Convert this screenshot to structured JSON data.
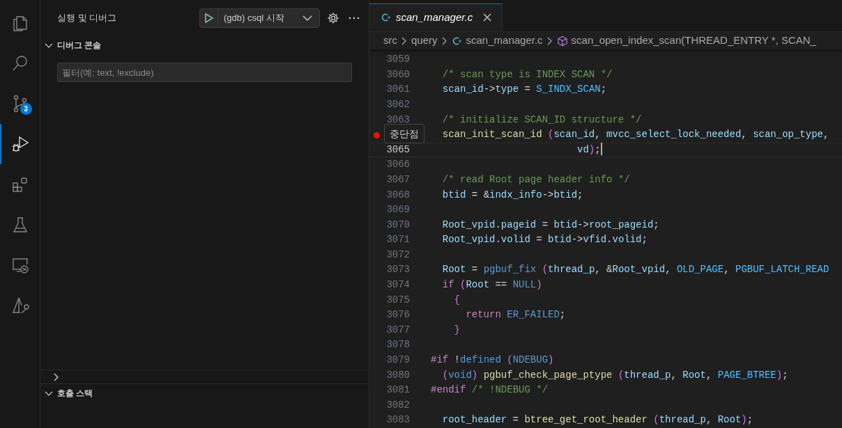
{
  "activity_bar": {
    "items": [
      {
        "kind": "files",
        "selected": false
      },
      {
        "kind": "search",
        "selected": false
      },
      {
        "kind": "source-control",
        "selected": false,
        "badge": "3"
      },
      {
        "kind": "run-debug",
        "selected": true
      },
      {
        "kind": "extensions",
        "selected": false
      },
      {
        "kind": "flask",
        "selected": false
      },
      {
        "kind": "remote",
        "selected": false
      },
      {
        "kind": "wrench-triangle",
        "selected": false
      }
    ]
  },
  "sidebar": {
    "title": "실행 및 디버그",
    "launch_config": "(gdb) csql 시작",
    "sections": [
      {
        "title": "디버그 콘솔",
        "expanded": true,
        "filter": {
          "placeholder": "필터(예: text, !exclude)"
        }
      },
      {
        "expanded": false
      },
      {
        "title": "호출 스택",
        "expanded": true
      }
    ]
  },
  "editor": {
    "tabs": [
      {
        "label": "scan_manager.c",
        "selected": true,
        "preview": true
      }
    ],
    "breadcrumbs": [
      {
        "label": "src",
        "kind": "folder"
      },
      {
        "label": "query",
        "kind": "folder"
      },
      {
        "label": "scan_manager.c",
        "kind": "file"
      },
      {
        "label": "scan_open_index_scan(THREAD_ENTRY *, SCAN_",
        "kind": "symbol"
      }
    ],
    "tooltip": "중단점",
    "lines": [
      {
        "number": "3059",
        "breakpoint": false,
        "current": false
      },
      {
        "number": "3060",
        "breakpoint": false,
        "current": false,
        "tokens": [
          {
            "kind": "comment",
            "text": "  /* scan type is INDEX SCAN */"
          }
        ]
      },
      {
        "number": "3061",
        "breakpoint": false,
        "current": false,
        "tokens": [
          {
            "kind": "variable",
            "text": "  scan_id"
          },
          {
            "kind": "punctuation",
            "text": "->"
          },
          {
            "kind": "variable",
            "text": "type"
          },
          {
            "kind": "punctuation",
            "text": " = "
          },
          {
            "kind": "constant",
            "text": "S_INDX_SCAN"
          },
          {
            "kind": "punctuation",
            "text": ";"
          }
        ]
      },
      {
        "number": "3062",
        "breakpoint": false,
        "current": false
      },
      {
        "number": "3063",
        "breakpoint": false,
        "current": false,
        "tokens": [
          {
            "kind": "comment",
            "text": "  /* initialize SCAN_ID structure */"
          }
        ]
      },
      {
        "breakpoint": true,
        "current": false,
        "tokens": [
          {
            "kind": "function",
            "text": "  scan_init_scan_id"
          },
          {
            "kind": "bracket",
            "text": " ("
          },
          {
            "kind": "variable",
            "text": "scan_id"
          },
          {
            "kind": "punctuation",
            "text": ", "
          },
          {
            "kind": "variable",
            "text": "mvcc_select_lock_needed"
          },
          {
            "kind": "punctuation",
            "text": ", "
          },
          {
            "kind": "variable",
            "text": "scan_op_type"
          },
          {
            "kind": "punctuation",
            "text": ","
          }
        ]
      },
      {
        "number": "3065",
        "breakpoint": false,
        "current": true,
        "tokens": [
          {
            "kind": "variable",
            "text": "                         vd"
          },
          {
            "kind": "bracket",
            "text": ")"
          },
          {
            "kind": "punctuation",
            "text": ";"
          }
        ]
      },
      {
        "number": "3066",
        "breakpoint": false,
        "current": false
      },
      {
        "number": "3067",
        "breakpoint": false,
        "current": false,
        "tokens": [
          {
            "kind": "comment",
            "text": "  /* read Root page header info */"
          }
        ]
      },
      {
        "number": "3068",
        "breakpoint": false,
        "current": false,
        "tokens": [
          {
            "kind": "variable",
            "text": "  btid"
          },
          {
            "kind": "punctuation",
            "text": " = &"
          },
          {
            "kind": "variable",
            "text": "indx_info"
          },
          {
            "kind": "punctuation",
            "text": "->"
          },
          {
            "kind": "variable",
            "text": "btid"
          },
          {
            "kind": "punctuation",
            "text": ";"
          }
        ]
      },
      {
        "number": "3069",
        "breakpoint": false,
        "current": false
      },
      {
        "number": "3070",
        "breakpoint": false,
        "current": false,
        "tokens": [
          {
            "kind": "variable",
            "text": "  Root_vpid"
          },
          {
            "kind": "punctuation",
            "text": "."
          },
          {
            "kind": "variable",
            "text": "pageid"
          },
          {
            "kind": "punctuation",
            "text": " = "
          },
          {
            "kind": "variable",
            "text": "btid"
          },
          {
            "kind": "punctuation",
            "text": "->"
          },
          {
            "kind": "variable",
            "text": "root_pageid"
          },
          {
            "kind": "punctuation",
            "text": ";"
          }
        ]
      },
      {
        "number": "3071",
        "breakpoint": false,
        "current": false,
        "tokens": [
          {
            "kind": "variable",
            "text": "  Root_vpid"
          },
          {
            "kind": "punctuation",
            "text": "."
          },
          {
            "kind": "variable",
            "text": "volid"
          },
          {
            "kind": "punctuation",
            "text": " = "
          },
          {
            "kind": "variable",
            "text": "btid"
          },
          {
            "kind": "punctuation",
            "text": "->"
          },
          {
            "kind": "variable",
            "text": "vfid"
          },
          {
            "kind": "punctuation",
            "text": "."
          },
          {
            "kind": "variable",
            "text": "volid"
          },
          {
            "kind": "punctuation",
            "text": ";"
          }
        ]
      },
      {
        "number": "3072",
        "breakpoint": false,
        "current": false
      },
      {
        "number": "3073",
        "breakpoint": false,
        "current": false,
        "tokens": [
          {
            "kind": "variable",
            "text": "  Root"
          },
          {
            "kind": "punctuation",
            "text": " = "
          },
          {
            "kind": "macro",
            "text": "pgbuf_fix"
          },
          {
            "kind": "bracket",
            "text": " ("
          },
          {
            "kind": "variable",
            "text": "thread_p"
          },
          {
            "kind": "punctuation",
            "text": ", &"
          },
          {
            "kind": "variable",
            "text": "Root_vpid"
          },
          {
            "kind": "punctuation",
            "text": ", "
          },
          {
            "kind": "constant",
            "text": "OLD_PAGE"
          },
          {
            "kind": "punctuation",
            "text": ", "
          },
          {
            "kind": "constant",
            "text": "PGBUF_LATCH_READ"
          }
        ]
      },
      {
        "number": "3074",
        "breakpoint": false,
        "current": false,
        "tokens": [
          {
            "kind": "keyword",
            "text": "  if"
          },
          {
            "kind": "bracket",
            "text": " ("
          },
          {
            "kind": "variable",
            "text": "Root"
          },
          {
            "kind": "punctuation",
            "text": " == "
          },
          {
            "kind": "macro",
            "text": "NULL"
          },
          {
            "kind": "bracket",
            "text": ")"
          }
        ]
      },
      {
        "number": "3075",
        "breakpoint": false,
        "current": false,
        "tokens": [
          {
            "kind": "bracket",
            "text": "    {"
          }
        ]
      },
      {
        "number": "3076",
        "breakpoint": false,
        "current": false,
        "tokens": [
          {
            "kind": "keyword",
            "text": "      return"
          },
          {
            "kind": "macro",
            "text": " ER_FAILED"
          },
          {
            "kind": "punctuation",
            "text": ";"
          }
        ]
      },
      {
        "number": "3077",
        "breakpoint": false,
        "current": false,
        "tokens": [
          {
            "kind": "bracket",
            "text": "    }"
          }
        ]
      },
      {
        "number": "3078",
        "breakpoint": false,
        "current": false
      },
      {
        "number": "3079",
        "breakpoint": false,
        "current": false,
        "tokens": [
          {
            "kind": "keyword",
            "text": "#if"
          },
          {
            "kind": "punctuation",
            "text": " !"
          },
          {
            "kind": "macro",
            "text": "defined"
          },
          {
            "kind": "bracket",
            "text": " ("
          },
          {
            "kind": "macro",
            "text": "NDEBUG"
          },
          {
            "kind": "bracket",
            "text": ")"
          }
        ]
      },
      {
        "number": "3080",
        "breakpoint": false,
        "current": false,
        "tokens": [
          {
            "kind": "bracket",
            "text": "  ("
          },
          {
            "kind": "macro",
            "text": "void"
          },
          {
            "kind": "bracket",
            "text": ")"
          },
          {
            "kind": "function",
            "text": " pgbuf_check_page_ptype"
          },
          {
            "kind": "bracket",
            "text": " ("
          },
          {
            "kind": "variable",
            "text": "thread_p"
          },
          {
            "kind": "punctuation",
            "text": ", "
          },
          {
            "kind": "variable",
            "text": "Root"
          },
          {
            "kind": "punctuation",
            "text": ", "
          },
          {
            "kind": "constant",
            "text": "PAGE_BTREE"
          },
          {
            "kind": "bracket",
            "text": ")"
          },
          {
            "kind": "punctuation",
            "text": ";"
          }
        ]
      },
      {
        "number": "3081",
        "breakpoint": false,
        "current": false,
        "tokens": [
          {
            "kind": "keyword",
            "text": "#endif"
          },
          {
            "kind": "comment",
            "text": " /* !NDEBUG */"
          }
        ]
      },
      {
        "number": "3082",
        "breakpoint": false,
        "current": false
      },
      {
        "number": "3083",
        "breakpoint": false,
        "current": false,
        "tokens": [
          {
            "kind": "variable",
            "text": "  root_header"
          },
          {
            "kind": "punctuation",
            "text": " = "
          },
          {
            "kind": "function",
            "text": "btree_get_root_header"
          },
          {
            "kind": "bracket",
            "text": " ("
          },
          {
            "kind": "variable",
            "text": "thread_p"
          },
          {
            "kind": "punctuation",
            "text": ", "
          },
          {
            "kind": "variable",
            "text": "Root"
          },
          {
            "kind": "bracket",
            "text": ")"
          },
          {
            "kind": "punctuation",
            "text": ";"
          }
        ]
      }
    ]
  }
}
